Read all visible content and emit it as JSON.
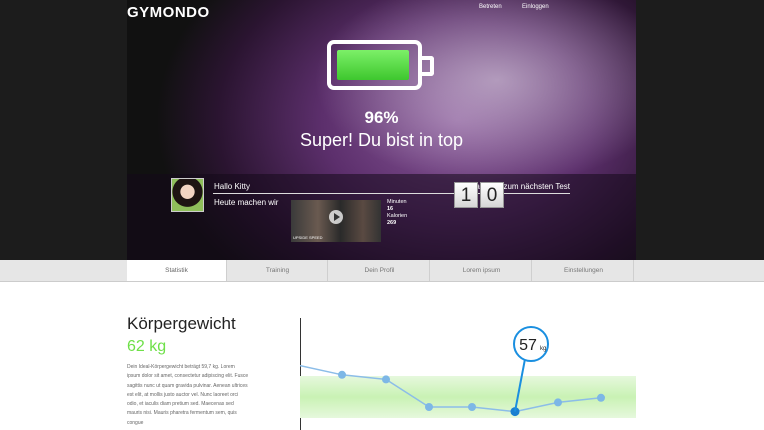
{
  "header": {
    "logo": "GYMONDO",
    "nav": [
      "Betreten",
      "Einloggen"
    ]
  },
  "hero": {
    "battery_level": 0.96,
    "percent": "96%",
    "message": "Super! Du bist in top",
    "colors": {
      "battery": "#4fd63a",
      "accent": "#6ee048"
    }
  },
  "info": {
    "greeting": "Hallo Kitty",
    "today_label": "Heute machen wir",
    "next_test_label": "Tage bis zum nächsten Test",
    "video_caption": "UPSIDE SPEED",
    "minutes_label": "Minuten",
    "minutes_value": "16",
    "calories_label": "Kalorien",
    "calories_value": "269",
    "counter": [
      "1",
      "0"
    ]
  },
  "tabs": [
    "Statistik",
    "Training",
    "Dein Profil",
    "Lorem ipsum",
    "Einstellungen"
  ],
  "content": {
    "title": "Körpergewicht",
    "weight": "62 kg",
    "paragraph": "Dein Ideal-Körpergewicht beträgt 59,7 kg. Lorem ipsum dolor sit amet, consectetur adipiscing elit. Fusce sagittis nunc ut quam gravida pulvinar. Aenean ultrices est elit, at mollis justo auctor vel. Nunc laoreet orci odio, et iaculis diam pretium sed. Maecenas sed mauris nisi. Mauris pharetra fermentum sem, quis congue"
  },
  "chart_data": {
    "type": "line",
    "highlight": {
      "value": "57",
      "unit": "kg",
      "index": 5
    },
    "values": [
      64,
      62,
      61,
      55,
      55,
      54,
      56,
      57
    ],
    "ylim": [
      50,
      70
    ]
  }
}
